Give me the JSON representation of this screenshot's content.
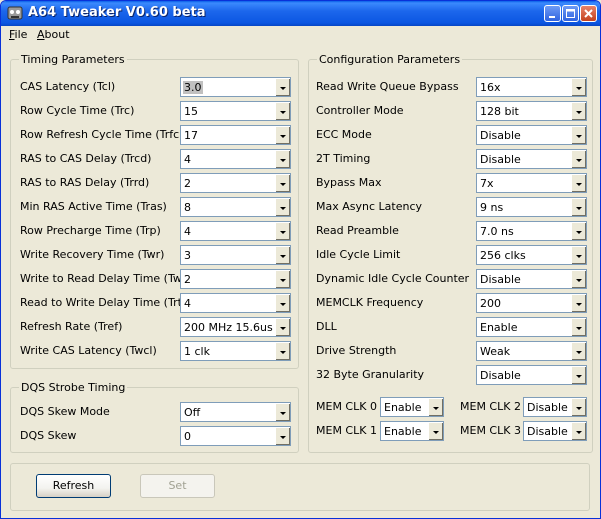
{
  "window": {
    "title": "A64 Tweaker V0.60 beta"
  },
  "menu": {
    "file": "File",
    "about": "About"
  },
  "timing": {
    "title": "Timing Parameters",
    "rows": [
      {
        "label": "CAS Latency (Tcl)",
        "value": "3.0"
      },
      {
        "label": "Row Cycle Time (Trc)",
        "value": "15"
      },
      {
        "label": "Row Refresh Cycle Time (Trfc)",
        "value": "17"
      },
      {
        "label": "RAS to CAS Delay (Trcd)",
        "value": "4"
      },
      {
        "label": "RAS to RAS Delay (Trrd)",
        "value": "2"
      },
      {
        "label": "Min RAS Active Time (Tras)",
        "value": "8"
      },
      {
        "label": "Row Precharge Time (Trp)",
        "value": "4"
      },
      {
        "label": "Write Recovery Time (Twr)",
        "value": "3"
      },
      {
        "label": "Write to Read Delay Time (Twtr)",
        "value": "2"
      },
      {
        "label": "Read to Write Delay Time (Trtw)",
        "value": "4"
      },
      {
        "label": "Refresh Rate (Tref)",
        "value": "200 MHz 15.6us"
      },
      {
        "label": "Write CAS Latency (Twcl)",
        "value": "1 clk"
      }
    ]
  },
  "dqs": {
    "title": "DQS Strobe Timing",
    "rows": [
      {
        "label": "DQS Skew Mode",
        "value": "Off"
      },
      {
        "label": "DQS Skew",
        "value": "0"
      }
    ]
  },
  "config": {
    "title": "Configuration Parameters",
    "rows": [
      {
        "label": "Read Write Queue Bypass",
        "value": "16x"
      },
      {
        "label": "Controller Mode",
        "value": "128 bit"
      },
      {
        "label": "ECC Mode",
        "value": "Disable"
      },
      {
        "label": "2T Timing",
        "value": "Disable"
      },
      {
        "label": "Bypass Max",
        "value": "7x"
      },
      {
        "label": "Max Async Latency",
        "value": "9 ns"
      },
      {
        "label": "Read Preamble",
        "value": "7.0 ns"
      },
      {
        "label": "Idle Cycle Limit",
        "value": "256 clks"
      },
      {
        "label": "Dynamic Idle Cycle Counter",
        "value": "Disable"
      },
      {
        "label": "MEMCLK Frequency",
        "value": "200"
      },
      {
        "label": "DLL",
        "value": "Enable"
      },
      {
        "label": "Drive Strength",
        "value": "Weak"
      },
      {
        "label": "32 Byte Granularity",
        "value": "Disable"
      }
    ],
    "memclk": [
      {
        "label": "MEM CLK 0",
        "value": "Enable"
      },
      {
        "label": "MEM CLK 2",
        "value": "Disable"
      },
      {
        "label": "MEM CLK 1",
        "value": "Enable"
      },
      {
        "label": "MEM CLK 3",
        "value": "Disable"
      }
    ]
  },
  "buttons": {
    "refresh": "Refresh",
    "set": "Set"
  }
}
